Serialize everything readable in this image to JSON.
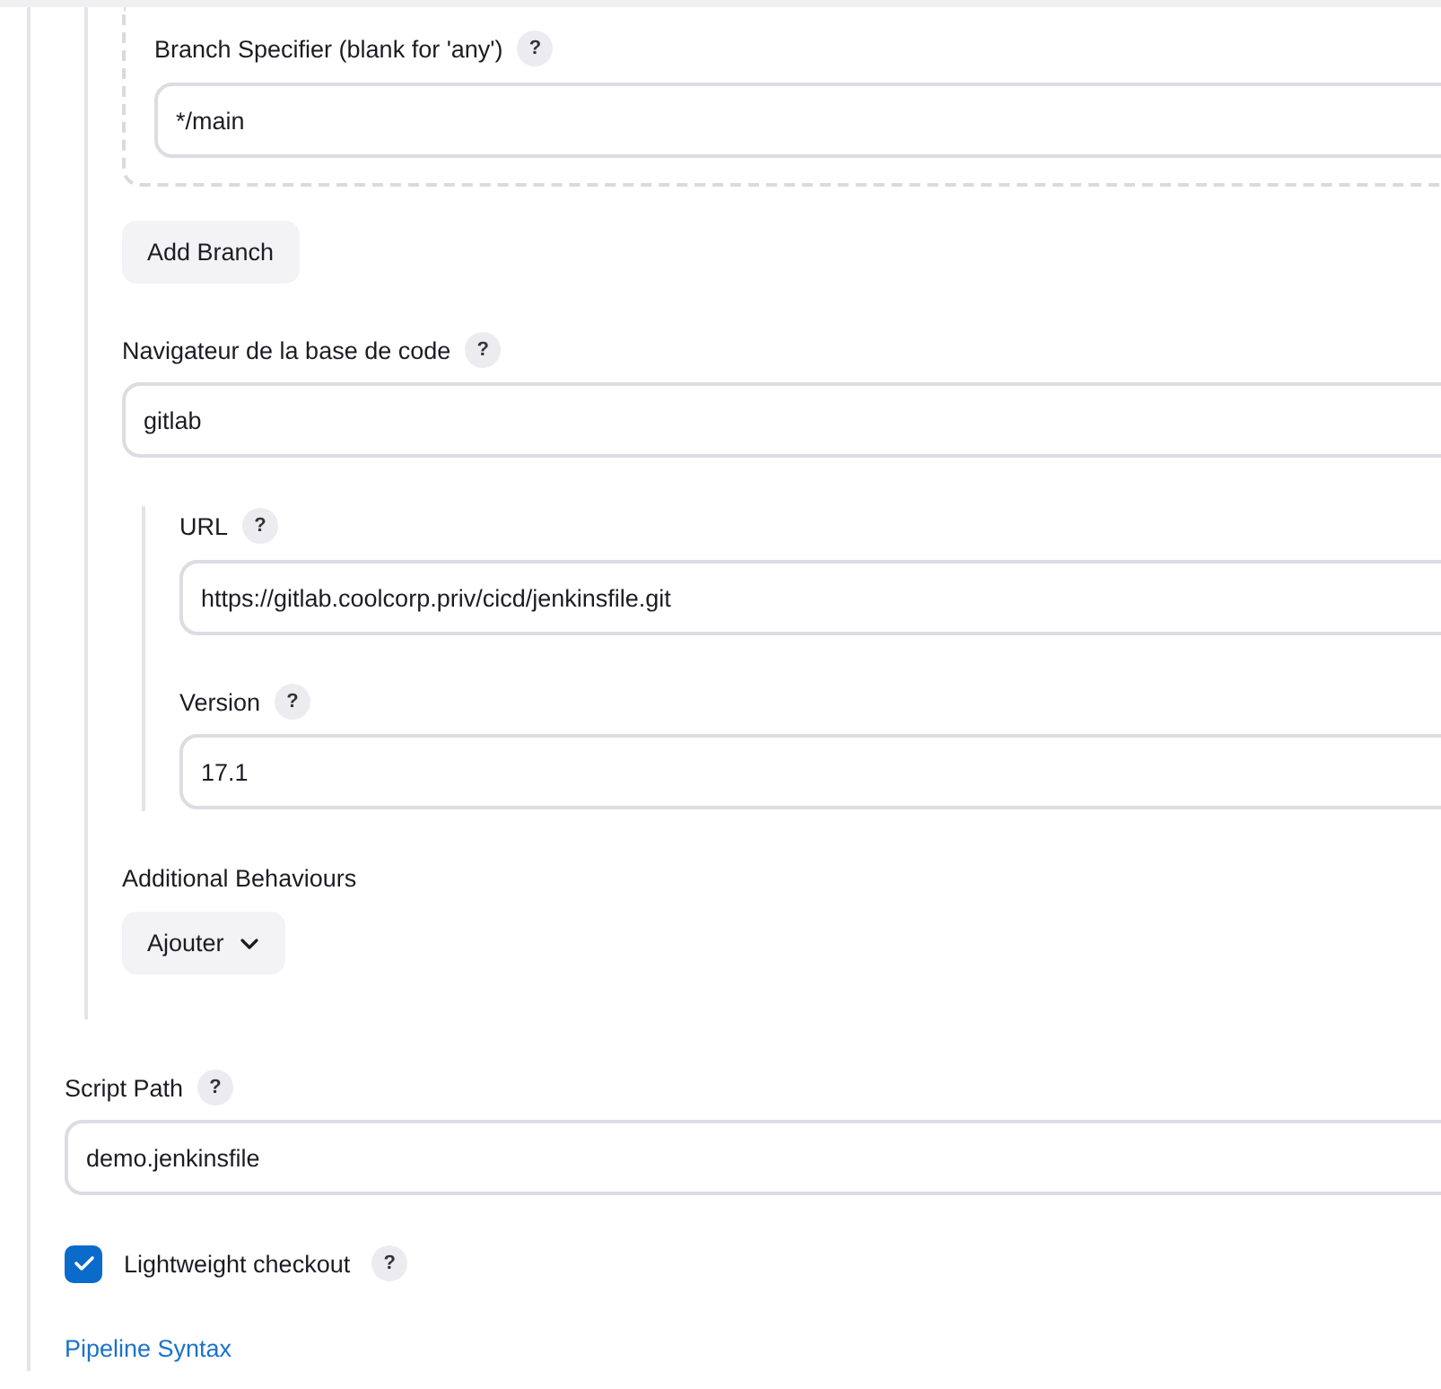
{
  "branch_specifier": {
    "label": "Branch Specifier (blank for 'any')",
    "help": "?",
    "value": "*/main"
  },
  "add_branch_button": "Add Branch",
  "repository_browser": {
    "label": "Navigateur de la base de code",
    "help": "?",
    "value": "gitlab",
    "fields": [
      {
        "label": "URL",
        "help": "?",
        "value": "https://gitlab.coolcorp.priv/cicd/jenkinsfile.git"
      },
      {
        "label": "Version",
        "help": "?",
        "value": "17.1"
      }
    ]
  },
  "additional_behaviours": {
    "label": "Additional Behaviours",
    "button": "Ajouter"
  },
  "script_path": {
    "label": "Script Path",
    "help": "?",
    "value": "demo.jenkinsfile"
  },
  "lightweight_checkout": {
    "label": "Lightweight checkout",
    "help": "?",
    "checked": true
  },
  "pipeline_syntax_link": "Pipeline Syntax"
}
